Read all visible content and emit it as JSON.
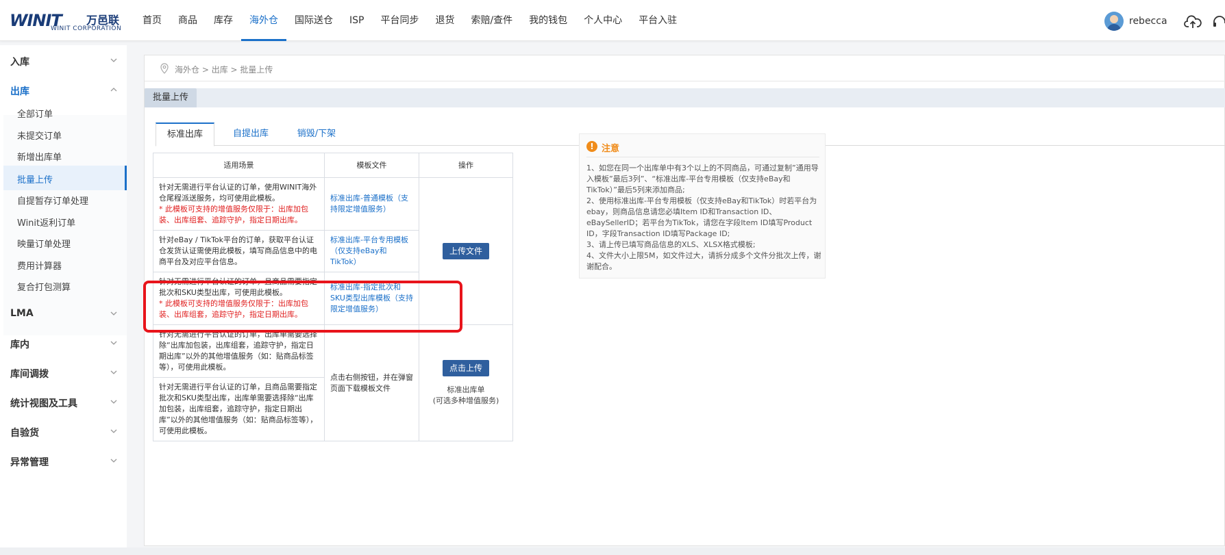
{
  "logo": {
    "mark": "WINIT",
    "cn": "万邑联",
    "sub": "WINIT CORPORATION"
  },
  "nav": [
    "首页",
    "商品",
    "库存",
    "海外仓",
    "国际送仓",
    "ISP",
    "平台同步",
    "退货",
    "索赔/查件",
    "我的钱包",
    "个人中心",
    "平台入驻"
  ],
  "nav_active": "海外仓",
  "user": {
    "name": "rebecca"
  },
  "sidebar": {
    "inbound": "入库",
    "outbound": "出库",
    "sub": [
      "全部订单",
      "未提交订单",
      "新增出库单",
      "批量上传",
      "自提暂存订单处理",
      "Winit返利订单",
      "映量订单处理",
      "费用计算器",
      "复合打包测算"
    ],
    "groups": [
      "LMA",
      "库内",
      "库间调拨",
      "统计视图及工具",
      "自验货",
      "异常管理"
    ]
  },
  "breadcrumb": {
    "a": "海外仓",
    "sep1": " > ",
    "b": "出库",
    "sep2": " > ",
    "c": "批量上传"
  },
  "panel_title": "批量上传",
  "tabs": [
    "标准出库",
    "自提出库",
    "销毁/下架"
  ],
  "table": {
    "headers": {
      "scene": "适用场景",
      "template": "模板文件",
      "op": "操作"
    },
    "rows": [
      {
        "scene": "针对无需进行平台认证的订单，使用WINIT海外仓尾程派送服务，均可使用此模板。",
        "red": "* 此模板可支持的增值服务仅限于：出库加包装、出库组套、追踪守护，指定日期出库。",
        "template": "标准出库-普通模板（支持限定增值服务）"
      },
      {
        "scene": "针对eBay / TikTok平台的订单，获取平台认证仓发货认证需使用此模板，填写商品信息中的电商平台及对应平台信息。",
        "red": "",
        "template": "标准出库-平台专用模板（仅支持eBay和TikTok）"
      },
      {
        "scene": "针对无需进行平台认证的订单，且商品需要指定批次和SKU类型出库，可使用此模板。",
        "red": "* 此模板可支持的增值服务仅限于：出库加包装、出库组套，追踪守护，指定日期出库。",
        "template": "标准出库-指定批次和SKU类型出库模板（支持限定增值服务）"
      },
      {
        "scene": "针对无需进行平台认证的订单，出库单需要选择除“出库加包装，出库组套，追踪守护，指定日期出库”以外的其他增值服务（如：贴商品标签等），可使用此模板。",
        "red": ""
      },
      {
        "scene": "针对无需进行平台认证的订单，且商品需要指定批次和SKU类型出库，出库单需要选择除“出库加包装，出库组套，追踪守护，指定日期出库”以外的其他增值服务（如：贴商品标签等），可使用此模板。",
        "red": ""
      }
    ],
    "merged_template": "点击右侧按钮，并在弹窗页面下载模板文件",
    "upload_btn": "上传文件",
    "click_upload_btn": "点击上传",
    "op_note_1": "标准出库单",
    "op_note_2": "(可选多种增值服务)"
  },
  "notice": {
    "title": "注意",
    "items": [
      "1、如您在同一个出库单中有3个以上的不同商品，可通过复制”通用导入模板”最后3列”、“标准出库-平台专用模板（仅支持eBay和TikTok）”最后5列来添加商品;",
      "2、使用标准出库-平台专用模板（仅支持eBay和TikTok）时若平台为ebay，则商品信息请您必填Item ID和Transaction ID、eBaySellerID；若平台为TikTok，请您在字段Item ID填写Product ID，字段Transaction ID填写Package ID;",
      "3、请上传已填写商品信息的XLS、XLSX格式模板;",
      "4、文件大小上限5M，如文件过大，请拆分成多个文件分批次上传，谢谢配合。"
    ]
  },
  "colors": {
    "accent": "#1b70c9",
    "button": "#2f5f9e",
    "warning": "#f08c1a",
    "highlight": "#e8141b"
  }
}
